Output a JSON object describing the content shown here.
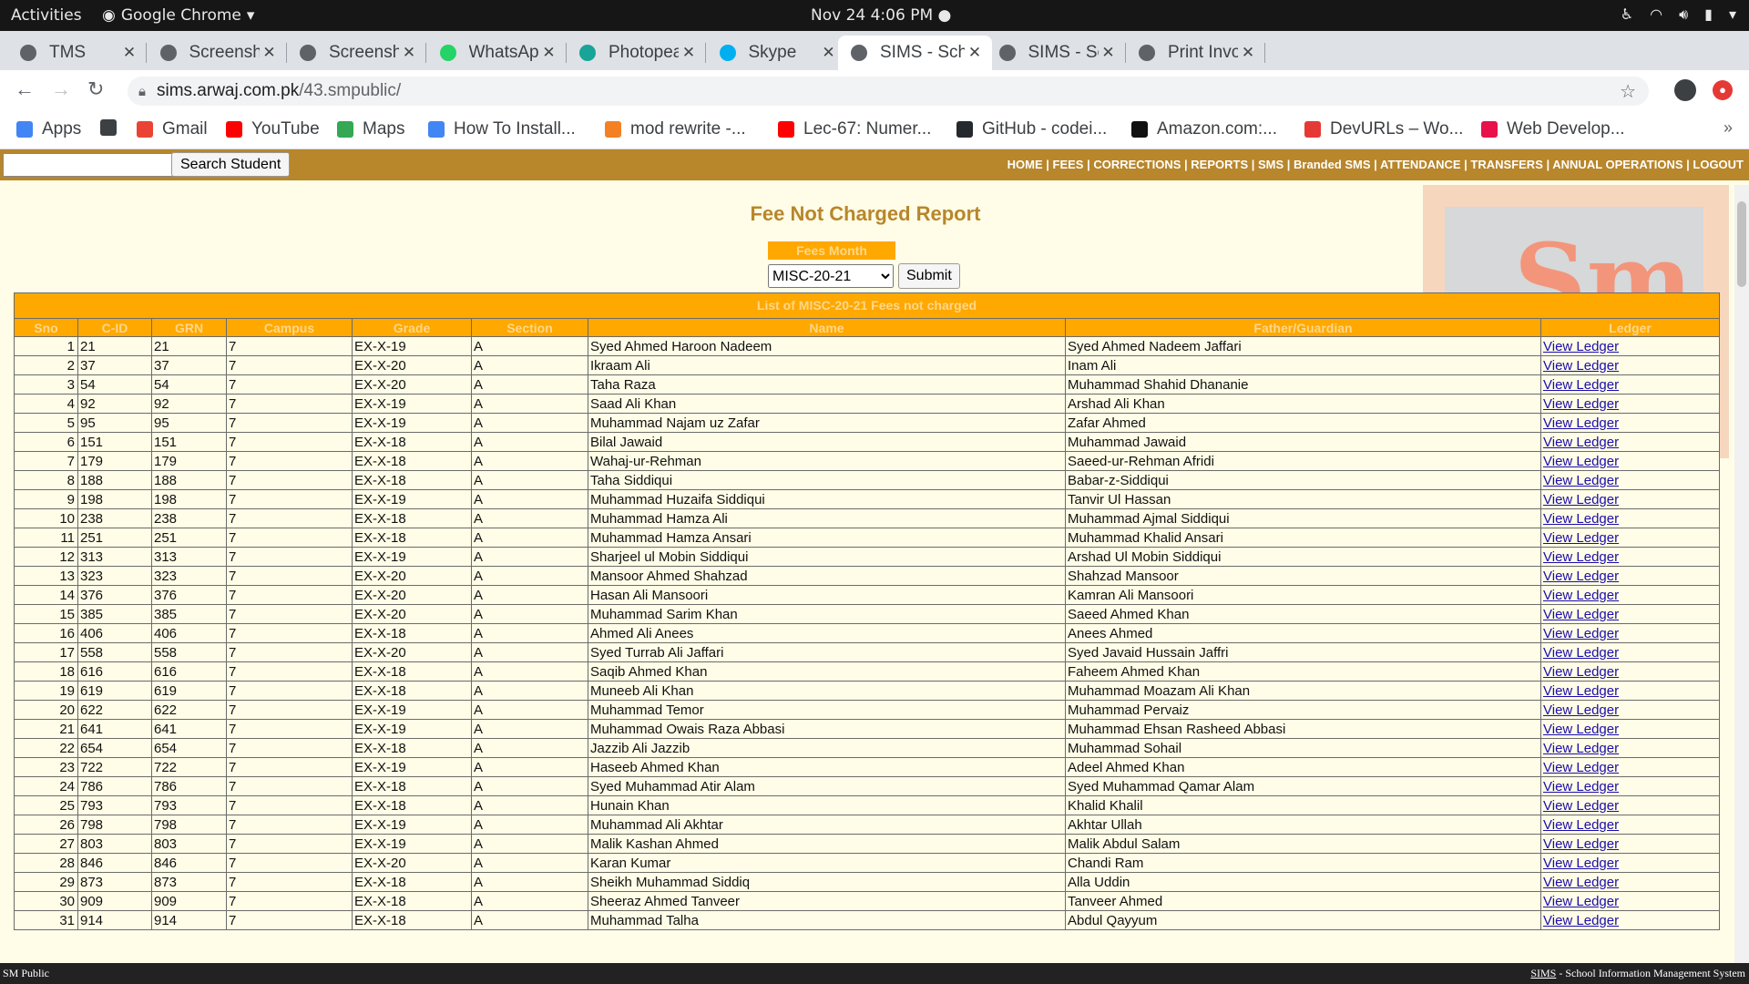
{
  "os": {
    "activities": "Activities",
    "app_name": "Google Chrome",
    "clock": "Nov 24  4:06 PM ●"
  },
  "tabs": [
    {
      "title": "TMS",
      "icon_color": "#5f6368"
    },
    {
      "title": "Screenshot_",
      "icon_color": "#5f6368"
    },
    {
      "title": "Screenshot_",
      "icon_color": "#5f6368"
    },
    {
      "title": "WhatsApp",
      "icon_color": "#25d366"
    },
    {
      "title": "Photopea | O",
      "icon_color": "#18a497"
    },
    {
      "title": "Skype",
      "icon_color": "#00aff0"
    },
    {
      "title": "SIMS - Schoo",
      "icon_color": "#5f6368",
      "active": true
    },
    {
      "title": "SIMS - Schoo",
      "icon_color": "#5f6368"
    },
    {
      "title": "Print Invoice",
      "icon_color": "#5f6368"
    }
  ],
  "url": {
    "host": "sims.arwaj.com.pk",
    "path": "/43.smpublic/"
  },
  "bookmarks": [
    {
      "label": "Apps",
      "icon": "apps-grid-icon",
      "color": "#4285f4"
    },
    {
      "label": "",
      "icon": "globe-icon",
      "color": "#3c4043"
    },
    {
      "label": "Gmail",
      "icon": "google-icon",
      "color": "#ea4335"
    },
    {
      "label": "YouTube",
      "icon": "youtube-icon",
      "color": "#ff0000"
    },
    {
      "label": "Maps",
      "icon": "maps-icon",
      "color": "#34a853"
    },
    {
      "label": "How To Install...",
      "icon": "site-icon",
      "color": "#4285f4"
    },
    {
      "label": "mod rewrite -...",
      "icon": "stackoverflow-icon",
      "color": "#f48024"
    },
    {
      "label": "Lec-67: Numer...",
      "icon": "youtube-icon",
      "color": "#ff0000"
    },
    {
      "label": "GitHub - codei...",
      "icon": "github-icon",
      "color": "#24292e"
    },
    {
      "label": "Amazon.com:...",
      "icon": "amazon-icon",
      "color": "#111111"
    },
    {
      "label": "DevURLs – Wo...",
      "icon": "devurls-icon",
      "color": "#e53935"
    },
    {
      "label": "Web Develop...",
      "icon": "site-icon",
      "color": "#e8114a"
    }
  ],
  "site": {
    "search_placeholder": "",
    "search_button": "Search Student",
    "nav": [
      "HOME",
      "FEES",
      "CORRECTIONS",
      "REPORTS",
      "SMS",
      "Branded SMS",
      "ATTENDANCE",
      "TRANSFERS",
      "ANNUAL OPERATIONS",
      "LOGOUT"
    ]
  },
  "report": {
    "title": "Fee Not Charged Report",
    "month_label": "Fees Month",
    "month_value": "MISC-20-21",
    "submit_label": "Submit",
    "table_caption": "List of MISC-20-21 Fees not charged",
    "columns": [
      "Sno",
      "C-ID",
      "GRN",
      "Campus",
      "Grade",
      "Section",
      "Name",
      "Father/Guardian",
      "Ledger"
    ],
    "rows": [
      [
        "1",
        "21",
        "21",
        "7",
        "EX-X-19",
        "A",
        "Syed Ahmed Haroon Nadeem",
        "Syed Ahmed Nadeem Jaffari",
        "View Ledger"
      ],
      [
        "2",
        "37",
        "37",
        "7",
        "EX-X-20",
        "A",
        "Ikraam Ali",
        "Inam Ali",
        "View Ledger"
      ],
      [
        "3",
        "54",
        "54",
        "7",
        "EX-X-20",
        "A",
        "Taha Raza",
        "Muhammad Shahid Dhananie",
        "View Ledger"
      ],
      [
        "4",
        "92",
        "92",
        "7",
        "EX-X-19",
        "A",
        "Saad Ali Khan",
        "Arshad Ali Khan",
        "View Ledger"
      ],
      [
        "5",
        "95",
        "95",
        "7",
        "EX-X-19",
        "A",
        "Muhammad Najam uz Zafar",
        "Zafar Ahmed",
        "View Ledger"
      ],
      [
        "6",
        "151",
        "151",
        "7",
        "EX-X-18",
        "A",
        "Bilal Jawaid",
        "Muhammad Jawaid",
        "View Ledger"
      ],
      [
        "7",
        "179",
        "179",
        "7",
        "EX-X-18",
        "A",
        "Wahaj-ur-Rehman",
        "Saeed-ur-Rehman Afridi",
        "View Ledger"
      ],
      [
        "8",
        "188",
        "188",
        "7",
        "EX-X-18",
        "A",
        "Taha Siddiqui",
        "Babar-z-Siddiqui",
        "View Ledger"
      ],
      [
        "9",
        "198",
        "198",
        "7",
        "EX-X-19",
        "A",
        "Muhammad Huzaifa Siddiqui",
        "Tanvir Ul Hassan",
        "View Ledger"
      ],
      [
        "10",
        "238",
        "238",
        "7",
        "EX-X-18",
        "A",
        "Muhammad Hamza Ali",
        "Muhammad Ajmal Siddiqui",
        "View Ledger"
      ],
      [
        "11",
        "251",
        "251",
        "7",
        "EX-X-18",
        "A",
        "Muhammad Hamza Ansari",
        "Muhammad Khalid Ansari",
        "View Ledger"
      ],
      [
        "12",
        "313",
        "313",
        "7",
        "EX-X-19",
        "A",
        "Sharjeel ul Mobin Siddiqui",
        "Arshad Ul Mobin Siddiqui",
        "View Ledger"
      ],
      [
        "13",
        "323",
        "323",
        "7",
        "EX-X-20",
        "A",
        "Mansoor Ahmed Shahzad",
        "Shahzad Mansoor",
        "View Ledger"
      ],
      [
        "14",
        "376",
        "376",
        "7",
        "EX-X-20",
        "A",
        "Hasan Ali Mansoori",
        "Kamran Ali Mansoori",
        "View Ledger"
      ],
      [
        "15",
        "385",
        "385",
        "7",
        "EX-X-20",
        "A",
        "Muhammad Sarim Khan",
        "Saeed Ahmed Khan",
        "View Ledger"
      ],
      [
        "16",
        "406",
        "406",
        "7",
        "EX-X-18",
        "A",
        "Ahmed Ali Anees",
        "Anees Ahmed",
        "View Ledger"
      ],
      [
        "17",
        "558",
        "558",
        "7",
        "EX-X-20",
        "A",
        "Syed Turrab Ali Jaffari",
        "Syed Javaid Hussain Jaffri",
        "View Ledger"
      ],
      [
        "18",
        "616",
        "616",
        "7",
        "EX-X-18",
        "A",
        "Saqib Ahmed Khan",
        "Faheem Ahmed Khan",
        "View Ledger"
      ],
      [
        "19",
        "619",
        "619",
        "7",
        "EX-X-18",
        "A",
        "Muneeb Ali Khan",
        "Muhammad Moazam Ali Khan",
        "View Ledger"
      ],
      [
        "20",
        "622",
        "622",
        "7",
        "EX-X-19",
        "A",
        "Muhammad Temor",
        "Muhammad Pervaiz",
        "View Ledger"
      ],
      [
        "21",
        "641",
        "641",
        "7",
        "EX-X-19",
        "A",
        "Muhammad Owais Raza Abbasi",
        "Muhammad Ehsan Rasheed Abbasi",
        "View Ledger"
      ],
      [
        "22",
        "654",
        "654",
        "7",
        "EX-X-18",
        "A",
        "Jazzib Ali Jazzib",
        "Muhammad Sohail",
        "View Ledger"
      ],
      [
        "23",
        "722",
        "722",
        "7",
        "EX-X-19",
        "A",
        "Haseeb Ahmed Khan",
        "Adeel Ahmed Khan",
        "View Ledger"
      ],
      [
        "24",
        "786",
        "786",
        "7",
        "EX-X-18",
        "A",
        "Syed Muhammad Atir Alam",
        "Syed Muhammad Qamar Alam",
        "View Ledger"
      ],
      [
        "25",
        "793",
        "793",
        "7",
        "EX-X-18",
        "A",
        "Hunain Khan",
        "Khalid Khalil",
        "View Ledger"
      ],
      [
        "26",
        "798",
        "798",
        "7",
        "EX-X-19",
        "A",
        "Muhammad Ali Akhtar",
        "Akhtar Ullah",
        "View Ledger"
      ],
      [
        "27",
        "803",
        "803",
        "7",
        "EX-X-19",
        "A",
        "Malik Kashan Ahmed",
        "Malik Abdul Salam",
        "View Ledger"
      ],
      [
        "28",
        "846",
        "846",
        "7",
        "EX-X-20",
        "A",
        "Karan Kumar",
        "Chandi Ram",
        "View Ledger"
      ],
      [
        "29",
        "873",
        "873",
        "7",
        "EX-X-18",
        "A",
        "Sheikh Muhammad Siddiq",
        "Alla Uddin",
        "View Ledger"
      ],
      [
        "30",
        "909",
        "909",
        "7",
        "EX-X-18",
        "A",
        "Sheeraz Ahmed Tanveer",
        "Tanveer Ahmed",
        "View Ledger"
      ],
      [
        "31",
        "914",
        "914",
        "7",
        "EX-X-18",
        "A",
        "Muhammad Talha",
        "Abdul Qayyum",
        "View Ledger"
      ]
    ]
  },
  "footer": {
    "left": "SM Public",
    "right_link": "SIMS",
    "right_text": " - School Information Management System"
  },
  "colors": {
    "accent": "#b8862b",
    "header_orange": "#ffa800",
    "page_bg": "#fffde7"
  }
}
